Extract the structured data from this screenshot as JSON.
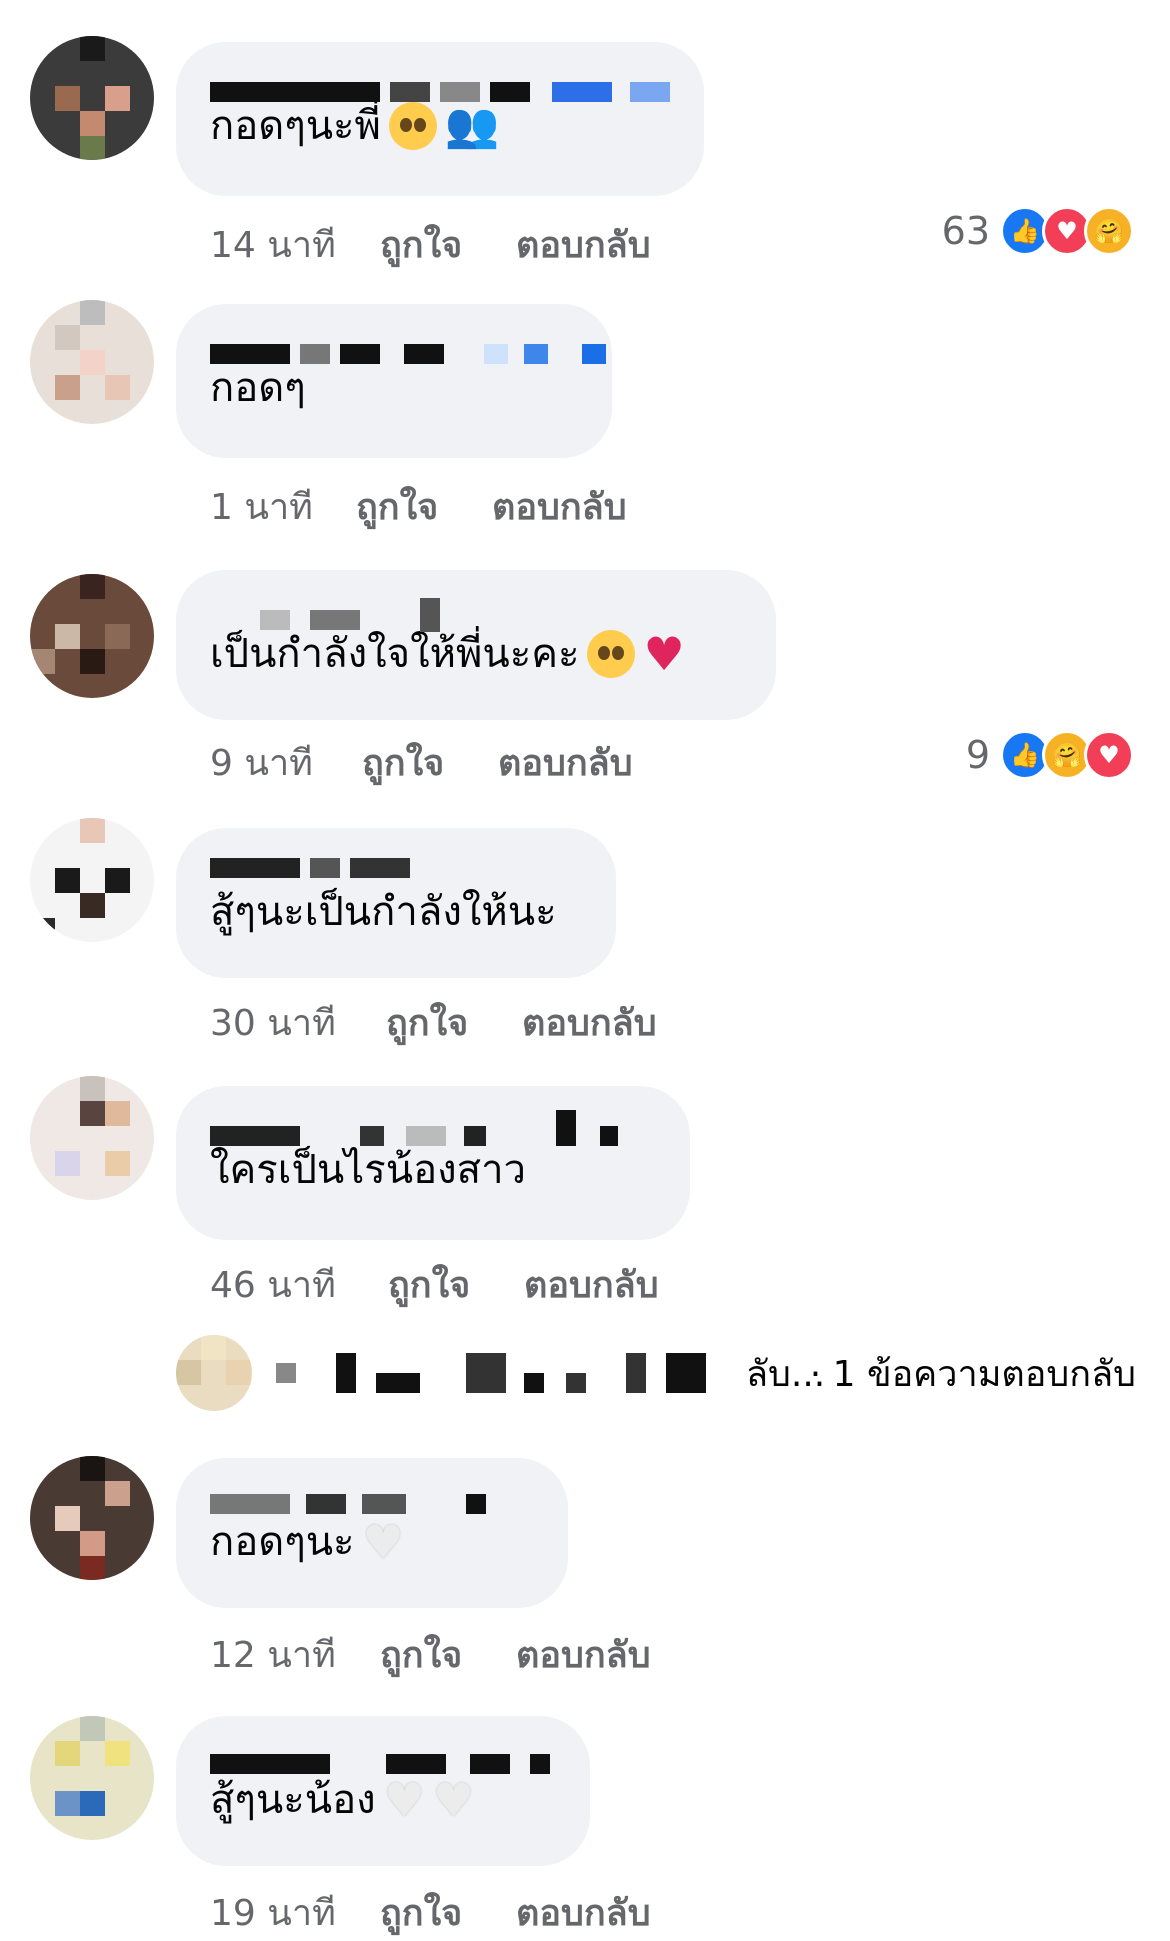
{
  "comments": [
    {
      "text": "กอดๆนะพี่",
      "emoji": [
        "pleading-face",
        "people-hugging"
      ],
      "time": "14 นาที",
      "like_label": "ถูกใจ",
      "reply_label": "ตอบกลับ",
      "reaction_count": "63",
      "reactions": [
        "like",
        "love",
        "care"
      ]
    },
    {
      "text": "กอดๆ",
      "emoji": [],
      "time": "1 นาที",
      "like_label": "ถูกใจ",
      "reply_label": "ตอบกลับ"
    },
    {
      "text": "เป็นกำลังใจให้พี่นะคะ",
      "emoji": [
        "pleading-face",
        "red-heart"
      ],
      "time": "9 นาที",
      "like_label": "ถูกใจ",
      "reply_label": "ตอบกลับ",
      "reaction_count": "9",
      "reactions": [
        "like",
        "care",
        "love"
      ]
    },
    {
      "text": "สู้ๆนะเป็นกำลังให้นะ",
      "emoji": [],
      "time": "30 นาที",
      "like_label": "ถูกใจ",
      "reply_label": "ตอบกลับ"
    },
    {
      "text": "ใครเป็นไรน้องสาว",
      "emoji": [],
      "time": "46 นาที",
      "like_label": "ถูกใจ",
      "reply_label": "ตอบกลับ"
    },
    {
      "text": "กอดๆนะ",
      "emoji": [
        "white-heart"
      ],
      "time": "12 นาที",
      "like_label": "ถูกใจ",
      "reply_label": "ตอบกลับ"
    },
    {
      "text": "สู้ๆนะน้อง",
      "emoji": [
        "white-heart",
        "white-heart"
      ],
      "time": "19 นาที",
      "like_label": "ถูกใจ",
      "reply_label": "ตอบกลับ"
    }
  ],
  "replies_summary": {
    "preview_tail": "ลับ...",
    "count_text": "· 1 ข้อความตอบกลับ"
  },
  "colors": {
    "bubble": "#f0f2f5",
    "meta": "#65676b",
    "like_blue": "#1877f2",
    "love_red": "#f33e58",
    "care_yellow": "#f7b125"
  },
  "reaction_glyphs": {
    "like": "👍",
    "love": "♥",
    "care": "🤗"
  }
}
